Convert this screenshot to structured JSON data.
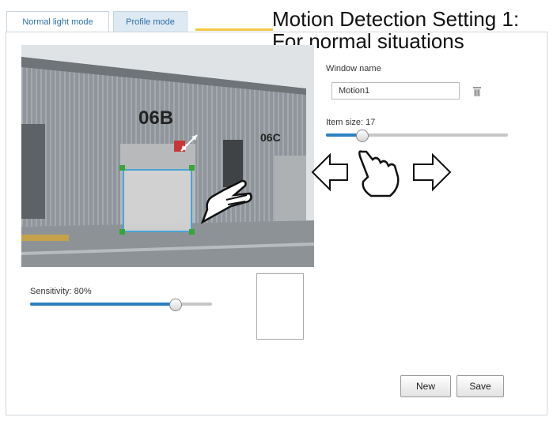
{
  "tabs": [
    {
      "label": "Normal light mode"
    },
    {
      "label": "Profile mode"
    }
  ],
  "annotation": {
    "title_line1": "Motion Detection Setting 1:",
    "title_line2": "For normal situations"
  },
  "video": {
    "building_label_left": "06B",
    "building_label_right": "06C"
  },
  "window": {
    "name_label": "Window name",
    "name_value": "Motion1"
  },
  "object_size": {
    "label": "Item size: 17",
    "value_fraction": 0.2
  },
  "sensitivity": {
    "label": "Sensitivity: 80%",
    "value_fraction": 0.8
  },
  "buttons": {
    "new_label": "New",
    "save_label": "Save"
  },
  "colors": {
    "accent": "#2c7fc0",
    "annotation_line": "#f2c744",
    "window_border": "#4aa3d8",
    "handle": "#3aa33a"
  }
}
